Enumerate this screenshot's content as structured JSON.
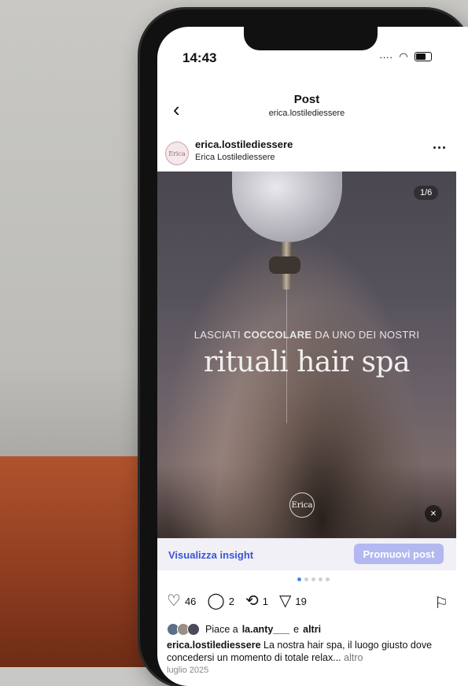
{
  "status": {
    "time": "14:43"
  },
  "nav": {
    "title": "Post",
    "subtitle": "erica.lostilediessere"
  },
  "account": {
    "username": "erica.lostilediessere",
    "name": "Erica Lostilediessere",
    "avatar_text": "Erica"
  },
  "media": {
    "counter": "1/6",
    "overline_prefix": "LASCIATI",
    "overline_bold": "COCCOLARE",
    "overline_suffix": "DA UNO DEI NOSTRI",
    "headline": "rituali hair spa",
    "logo_text": "Erica",
    "mute_icon": "speaker-muted-icon"
  },
  "insight": {
    "link": "Visualizza insight",
    "promote": "Promuovi post"
  },
  "carousel": {
    "total": 6,
    "current": 1
  },
  "actions": {
    "likes": "46",
    "comments": "2",
    "reposts": "1",
    "shares": "19"
  },
  "liked_by": {
    "prefix": "Piace a",
    "user": "la.anty___",
    "joiner": "e",
    "others": "altri"
  },
  "caption": {
    "username": "erica.lostilediessere",
    "text": "La nostra hair spa, il luogo giusto dove concedersi un momento di totale relax...",
    "more": "altro"
  },
  "date": "luglio 2025",
  "colors": {
    "accent": "#3a55d6",
    "promote_bg": "#b3b8f0",
    "carousel_active": "#4a86f0"
  }
}
